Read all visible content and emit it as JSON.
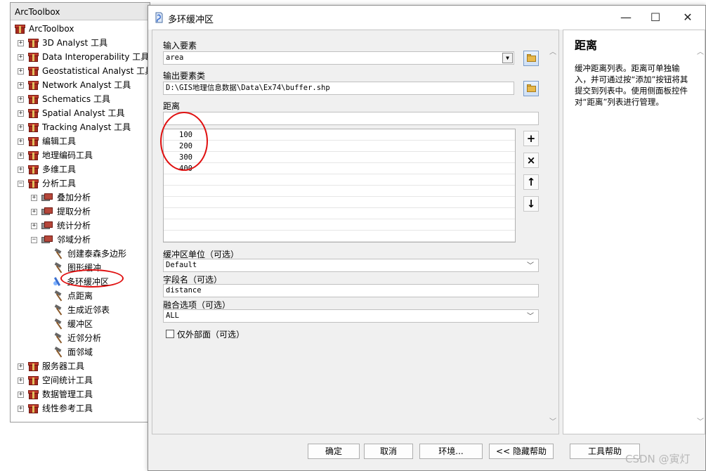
{
  "toolbox": {
    "title": "ArcToolbox",
    "root": "ArcToolbox",
    "items": [
      {
        "label": "3D Analyst 工具",
        "level": 1,
        "type": "toolbox",
        "exp": "+"
      },
      {
        "label": "Data Interoperability 工具",
        "level": 1,
        "type": "toolbox",
        "exp": "+"
      },
      {
        "label": "Geostatistical Analyst 工具",
        "level": 1,
        "type": "toolbox",
        "exp": "+"
      },
      {
        "label": "Network Analyst 工具",
        "level": 1,
        "type": "toolbox",
        "exp": "+"
      },
      {
        "label": "Schematics 工具",
        "level": 1,
        "type": "toolbox",
        "exp": "+"
      },
      {
        "label": "Spatial Analyst 工具",
        "level": 1,
        "type": "toolbox",
        "exp": "+"
      },
      {
        "label": "Tracking Analyst 工具",
        "level": 1,
        "type": "toolbox",
        "exp": "+"
      },
      {
        "label": "编辑工具",
        "level": 1,
        "type": "toolbox",
        "exp": "+"
      },
      {
        "label": "地理编码工具",
        "level": 1,
        "type": "toolbox",
        "exp": "+"
      },
      {
        "label": "多维工具",
        "level": 1,
        "type": "toolbox",
        "exp": "+"
      },
      {
        "label": "分析工具",
        "level": 1,
        "type": "toolbox",
        "exp": "-"
      },
      {
        "label": "叠加分析",
        "level": 2,
        "type": "toolset",
        "exp": "+"
      },
      {
        "label": "提取分析",
        "level": 2,
        "type": "toolset",
        "exp": "+"
      },
      {
        "label": "统计分析",
        "level": 2,
        "type": "toolset",
        "exp": "+"
      },
      {
        "label": "邻域分析",
        "level": 2,
        "type": "toolset",
        "exp": "-"
      },
      {
        "label": "创建泰森多边形",
        "level": 3,
        "type": "tool",
        "exp": ""
      },
      {
        "label": "图形缓冲",
        "level": 3,
        "type": "tool",
        "exp": ""
      },
      {
        "label": "多环缓冲区",
        "level": 3,
        "type": "script",
        "exp": ""
      },
      {
        "label": "点距离",
        "level": 3,
        "type": "tool",
        "exp": ""
      },
      {
        "label": "生成近邻表",
        "level": 3,
        "type": "tool",
        "exp": ""
      },
      {
        "label": "缓冲区",
        "level": 3,
        "type": "tool",
        "exp": ""
      },
      {
        "label": "近邻分析",
        "level": 3,
        "type": "tool",
        "exp": ""
      },
      {
        "label": "面邻域",
        "level": 3,
        "type": "tool",
        "exp": ""
      },
      {
        "label": "服务器工具",
        "level": 1,
        "type": "toolbox",
        "exp": "+"
      },
      {
        "label": "空间统计工具",
        "level": 1,
        "type": "toolbox",
        "exp": "+"
      },
      {
        "label": "数据管理工具",
        "level": 1,
        "type": "toolbox",
        "exp": "+"
      },
      {
        "label": "线性参考工具",
        "level": 1,
        "type": "toolbox",
        "exp": "+"
      }
    ]
  },
  "dialog": {
    "title": "多环缓冲区",
    "controls": {
      "minimize": "—",
      "maximize": "☐",
      "close": "✕"
    },
    "input_label": "输入要素",
    "input_value": "area",
    "output_label": "输出要素类",
    "output_value": "D:\\GIS地理信息数据\\Data\\Ex74\\buffer.shp",
    "distance_label": "距离",
    "distance_input": "",
    "distances": [
      "100",
      "200",
      "300",
      "400"
    ],
    "list_buttons": {
      "add": "+",
      "remove": "×",
      "up": "↑",
      "down": "↓"
    },
    "unit_label": "缓冲区单位（可选）",
    "unit_value": "Default",
    "field_label": "字段名（可选）",
    "field_value": "distance",
    "dissolve_label": "融合选项（可选）",
    "dissolve_value": "ALL",
    "outside_label": "仅外部面（可选）",
    "help_title": "距离",
    "help_text": "缓冲距离列表。距离可单独输入，并可通过按“添加”按钮将其提交到列表中。使用侧面板控件对“距离”列表进行管理。",
    "buttons": {
      "ok": "确定",
      "cancel": "取消",
      "env": "环境...",
      "hide_help": "<< 隐藏帮助",
      "tool_help": "工具帮助"
    }
  },
  "watermark": "CSDN @寅灯",
  "colors": {
    "annotation": "#e01010",
    "tool_icon": "#a82a1e"
  }
}
